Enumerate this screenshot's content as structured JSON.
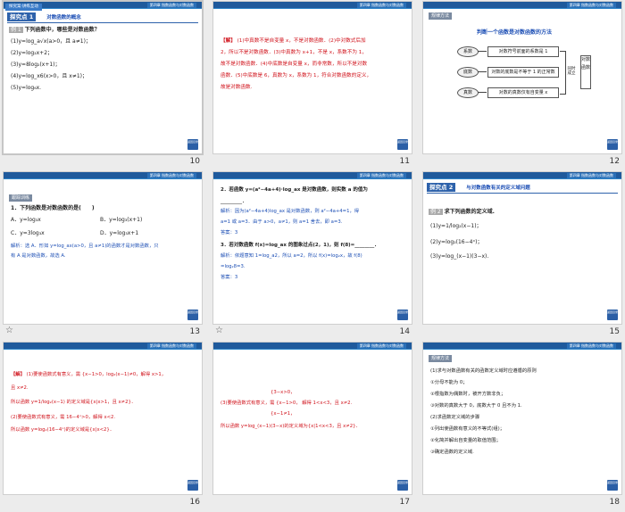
{
  "slides": [
    {
      "num": "10",
      "chapter": "第四章 指数函数与对数函数",
      "tab": "探究案·讲练互动",
      "header_tag": "探究点 1",
      "header_title": "对数函数的概念",
      "example_tag": "例 1",
      "question": "下列函数中，哪些是对数函数？",
      "items": [
        "(1)y=log_a√x(a>0，且 a≠1)；",
        "(2)y=log₂x+2；",
        "(3)y=8log₂(x+1)；",
        "(4)y=log_x6(x>0，且 x≠1)；",
        "(5)y=log₆x."
      ],
      "nav": "返回目录"
    },
    {
      "num": "11",
      "chapter": "第四章 指数函数与对数函数",
      "answer_label": "【解】",
      "lines": [
        "(1)中真数不是自变量 x，不是对数函数．(2)中对数式后加",
        "2，所以不是对数函数．(3)中真数为 x+1，不是 x，系数不为 1，",
        "故不是对数函数．(4)中底数是自变量 x，而非常数，所以不是对数",
        "函数．(5)中底数是 6，真数为 x，系数为 1，符合对数函数的定义，",
        "故是对数函数."
      ],
      "nav": "返回目录"
    },
    {
      "num": "12",
      "chapter": "第四章 指数函数与对数函数",
      "tag": "规律方法",
      "title": "判断一个函数是对数函数的方法",
      "ovals": [
        "系数",
        "底数",
        "真数"
      ],
      "boxes": [
        "对数符号前面的系数是 1",
        "对数的底数是不等于 1 的正常数",
        "对数的真数仅有自变量 x"
      ],
      "mid": "同时成立",
      "result": "对数函数",
      "nav": "返回目录"
    },
    {
      "num": "13",
      "chapter": "第四章 指数函数与对数函数",
      "tag": "跟踪训练",
      "question": "1．下列函数是对数函数的是(　　)",
      "options": [
        "A．y=log₃x",
        "B．y=log₃(x+1)",
        "C．y=3log₃x",
        "D．y=log₃x+1"
      ],
      "explain": [
        "解析：选 A．形如 y=log_ax(a>0，且 a≠1)的函数才是对数函数，只",
        "有 A 是对数函数，故选 A."
      ],
      "nav": "返回目录"
    },
    {
      "num": "14",
      "chapter": "第四章 指数函数与对数函数",
      "q2": "2．若函数 y=(a²−4a+4)·log_ax 是对数函数，则实数 a 的值为",
      "blank": "________．",
      "a2": [
        "解析：因为(a²−4a+4)log_ax 是对数函数，则 a²−4a+4=1，得",
        "a=1 或 a=3．由于 a>0，a≠1，则 a=1 舍去，即 a=3."
      ],
      "ans2": "答案：3",
      "q3": "3．若对数函数 f(x)=log_ax 的图象过点(2，1)，则 f(8)=________．",
      "a3": [
        "解析：依题意知 1=log_a2，所以 a=2，所以 f(x)=log₂x，故 f(8)",
        "=log₂8=3."
      ],
      "ans3": "答案：3",
      "nav": "返回目录"
    },
    {
      "num": "15",
      "chapter": "第四章 指数函数与对数函数",
      "header_tag": "探究点 2",
      "header_title": "与对数函数有关的定义域问题",
      "example_tag": "例 2",
      "question": "求下列函数的定义域.",
      "items": [
        "(1)y=1/log₂(x−1)；",
        "(2)y=log₂(16−4ˣ)；",
        "(3)y=log_(x−1)(3−x)."
      ],
      "nav": "返回目录"
    },
    {
      "num": "16",
      "chapter": "第四章 指数函数与对数函数",
      "answer_label": "【解】",
      "lines": [
        "(1)要使函数式有意义，需 {x−1>0，log₂(x−1)≠0，解得 x>1，",
        "且 x≠2.",
        "所以函数 y=1/log₂(x−1) 的定义域是{x|x>1，且 x≠2}．",
        "(2)要使函数式有意义，需 16−4ˣ>0，解得 x<2.",
        "所以函数 y=log₂(16−4ˣ)的定义域是{x|x<2}．"
      ],
      "nav": "返回目录"
    },
    {
      "num": "17",
      "chapter": "第四章 指数函数与对数函数",
      "lines": [
        "{3−x>0，",
        "(3)要使函数式有意义，需 {x−1>0，  解得 1<x<3，且 x≠2.",
        "{x−1≠1，",
        "所以函数 y=log_(x−1)(3−x)的定义域为{x|1<x<3，且 x≠2}．"
      ],
      "nav": "返回目录"
    },
    {
      "num": "18",
      "chapter": "第四章 指数函数与对数函数",
      "tag": "规律方法",
      "lines": [
        "(1)求与对数函数有关的函数定义域时应遵循的原则",
        "①分母不能为 0；",
        "②根指数为偶数时，被开方数非负；",
        "③对数的真数大于 0，底数大于 0 且不为 1.",
        "(2)求函数定义域的步骤",
        "①列出使函数有意义的不等式(组)；",
        "②化简并解出自变量的取值范围；",
        "③确定函数的定义域."
      ],
      "nav": "返回目录"
    }
  ],
  "colors": {
    "answer": "#d0121b",
    "header": "#1f5a9c",
    "accent": "#2e62ab"
  }
}
